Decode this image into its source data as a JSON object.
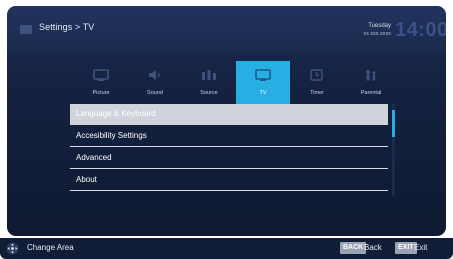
{
  "header": {
    "title": "Settings > TV",
    "day": "Tuesday",
    "date": "xx.xxx.xxxx",
    "time": "14:00"
  },
  "tabs": [
    {
      "label": "Picture",
      "icon": "picture-icon"
    },
    {
      "label": "Sound",
      "icon": "sound-icon"
    },
    {
      "label": "Source",
      "icon": "source-icon"
    },
    {
      "label": "TV",
      "icon": "tv-icon",
      "active": true
    },
    {
      "label": "Timer",
      "icon": "timer-icon"
    },
    {
      "label": "Parental",
      "icon": "parental-icon"
    }
  ],
  "menu": [
    {
      "label": "Language & Keyboard",
      "selected": true
    },
    {
      "label": "Accesibility Settings"
    },
    {
      "label": "Advanced"
    },
    {
      "label": "About"
    }
  ],
  "footer": {
    "change_area": "Change Area",
    "back_key": "BACK",
    "back_label": "Back",
    "exit_key": "EXIT",
    "exit_label": "Exit"
  },
  "colors": {
    "accent": "#27aee3",
    "panel": "#14213f",
    "selected_row": "#cfd3da"
  }
}
